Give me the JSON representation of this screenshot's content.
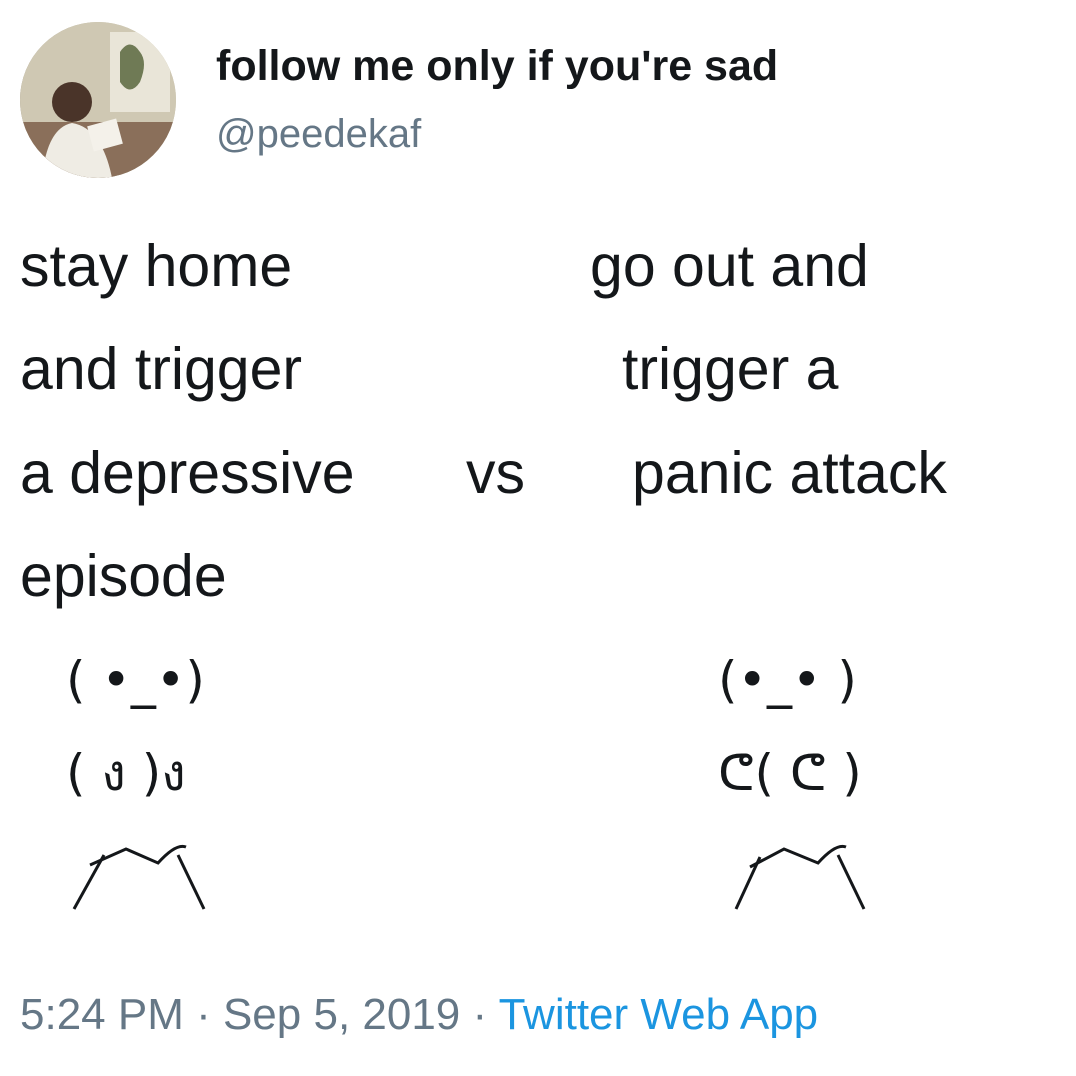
{
  "tweet": {
    "display_name": "follow me only if you're sad",
    "handle": "@peedekaf",
    "left_column": [
      "stay home",
      "and trigger",
      "a depressive",
      "episode"
    ],
    "vs": "vs",
    "right_column": [
      "go out and",
      "trigger a",
      "panic attack"
    ],
    "left_figure": {
      "head": "( •_•)",
      "body": "( ง )ง"
    },
    "right_figure": {
      "head": "(•_• )",
      "body": "ᕦ( ᕦ )"
    },
    "timestamp": "5:24 PM · Sep 5, 2019 · ",
    "source": "Twitter Web App"
  },
  "colors": {
    "text": "#14171a",
    "secondary": "#657786",
    "link": "#1b95e0"
  },
  "icons": {
    "avatar": "profile-photo"
  }
}
